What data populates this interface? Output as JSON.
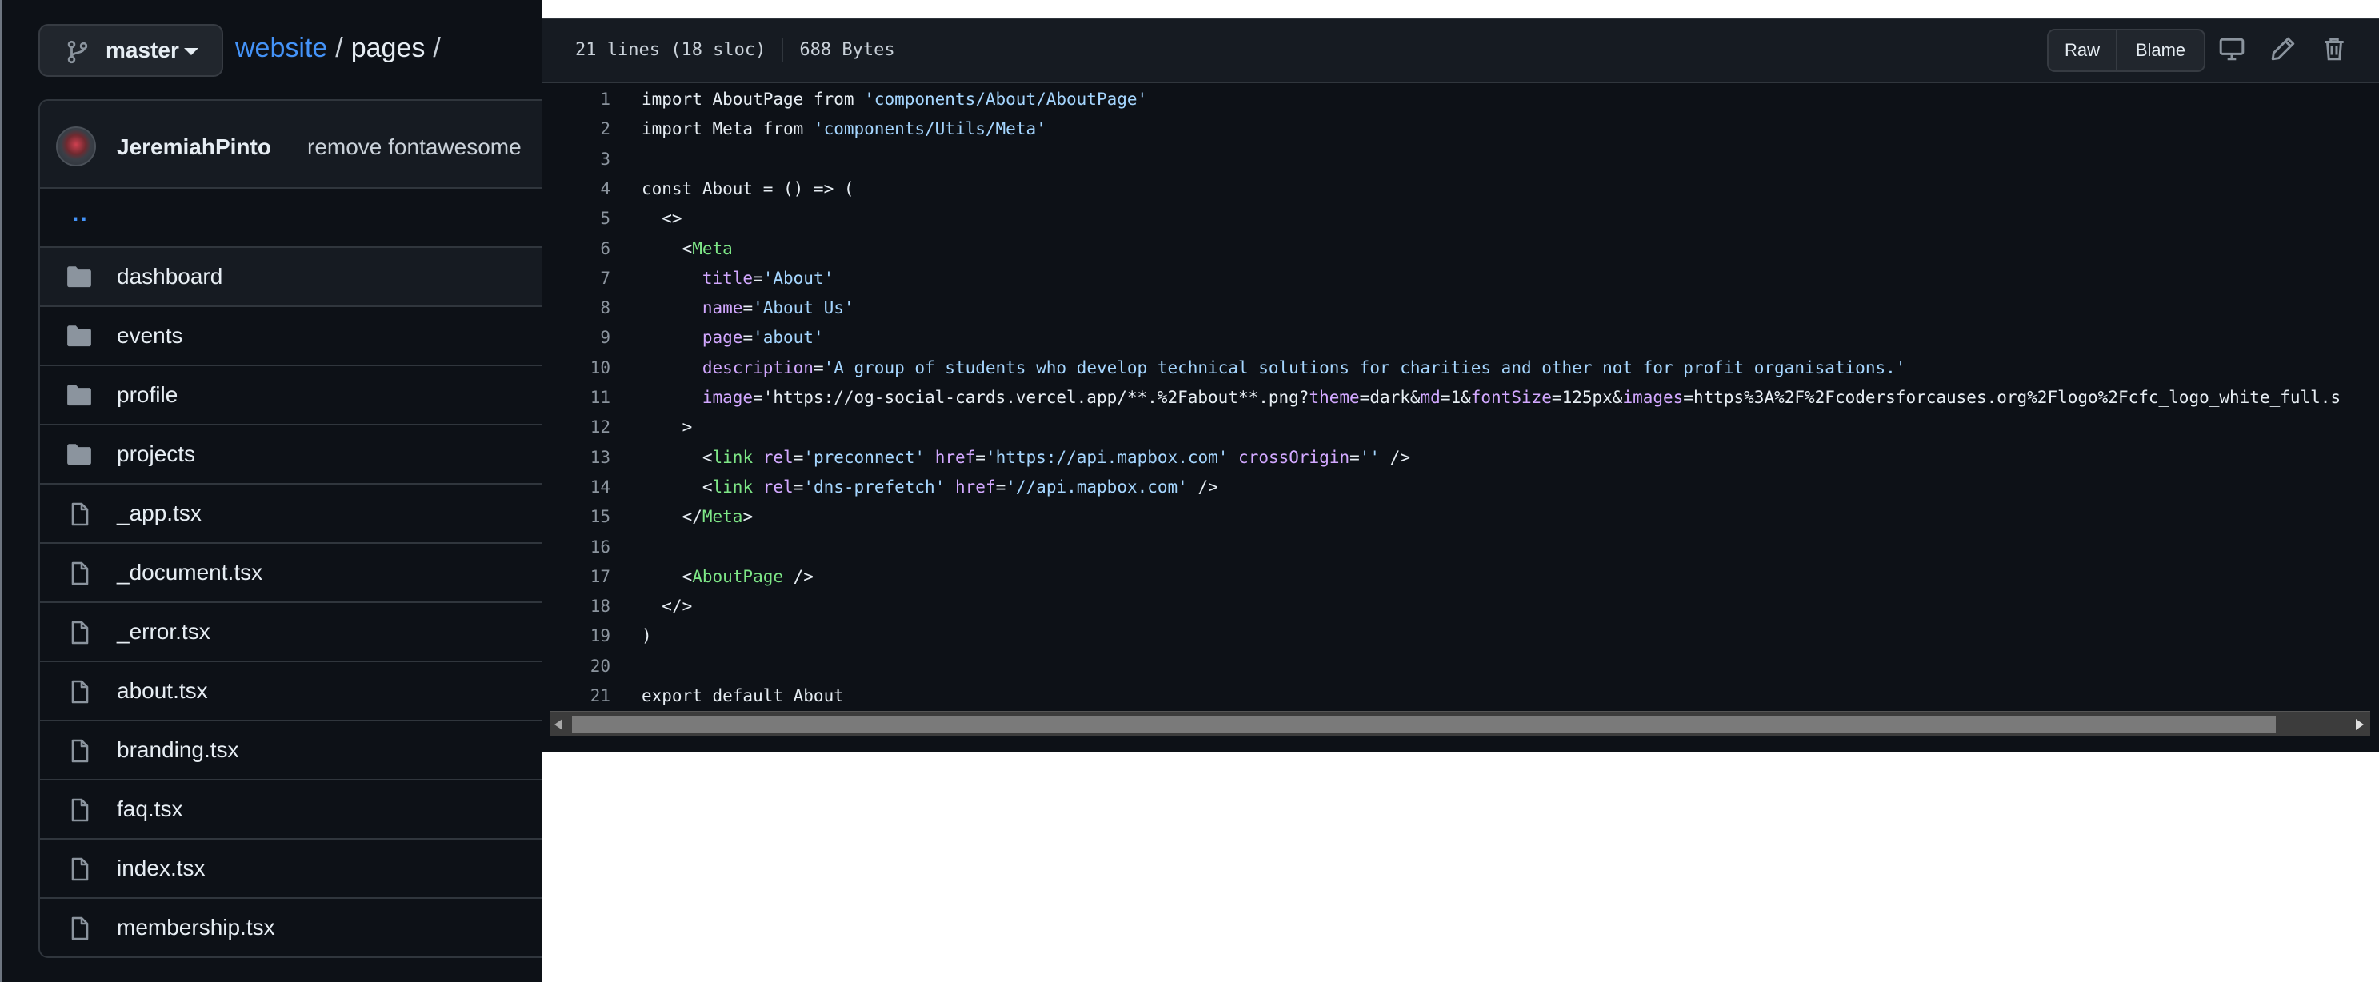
{
  "repo": {
    "branch": "master",
    "breadcrumb": {
      "repo": "website",
      "separator": "/",
      "dir": "pages",
      "trailing": "/"
    }
  },
  "commit": {
    "author": "JeremiahPinto",
    "message": "remove fontawesome"
  },
  "file_list": {
    "parent_link": "..",
    "items": [
      {
        "name": "dashboard",
        "type": "folder"
      },
      {
        "name": "events",
        "type": "folder"
      },
      {
        "name": "profile",
        "type": "folder"
      },
      {
        "name": "projects",
        "type": "folder"
      },
      {
        "name": "_app.tsx",
        "type": "file"
      },
      {
        "name": "_document.tsx",
        "type": "file"
      },
      {
        "name": "_error.tsx",
        "type": "file"
      },
      {
        "name": "about.tsx",
        "type": "file"
      },
      {
        "name": "branding.tsx",
        "type": "file"
      },
      {
        "name": "faq.tsx",
        "type": "file"
      },
      {
        "name": "index.tsx",
        "type": "file"
      },
      {
        "name": "membership.tsx",
        "type": "file"
      }
    ]
  },
  "file_header": {
    "lines_info": "21 lines (18 sloc)",
    "size": "688 Bytes",
    "raw_label": "Raw",
    "blame_label": "Blame",
    "icons": [
      "desktop-icon",
      "pencil-icon",
      "trash-icon"
    ]
  },
  "code": {
    "lines": [
      "import AboutPage from 'components/About/AboutPage'",
      "import Meta from 'components/Utils/Meta'",
      "",
      "const About = () => (",
      "  <>",
      "    <Meta",
      "      title='About'",
      "      name='About Us'",
      "      page='about'",
      "      description='A group of students who develop technical solutions for charities and other not for profit organisations.'",
      "      image='https://og-social-cards.vercel.app/**.%2Fabout**.png?theme=dark&md=1&fontSize=125px&images=https%3A%2F%2Fcodersforcauses.org%2Flogo%2Fcfc_logo_white_full.s",
      "    >",
      "      <link rel='preconnect' href='https://api.mapbox.com' crossOrigin='' />",
      "      <link rel='dns-prefetch' href='//api.mapbox.com' />",
      "    </Meta>",
      "",
      "    <AboutPage />",
      "  </>",
      ")",
      "",
      "export default About"
    ]
  },
  "colors": {
    "background": "#0d1117",
    "header": "#161b22",
    "border": "#30363d",
    "link": "#4493f8",
    "tag": "#7ee787",
    "attribute": "#d2a8ff",
    "string": "#a5d6ff"
  }
}
